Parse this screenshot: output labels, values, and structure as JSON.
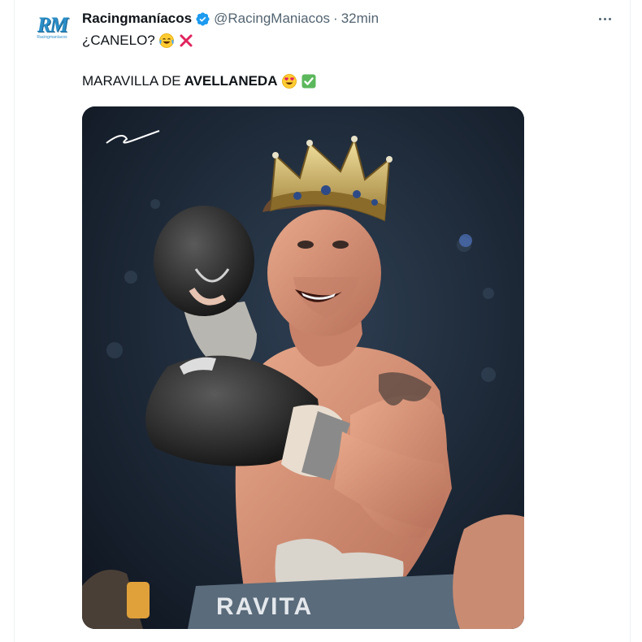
{
  "tweet": {
    "avatar_text": "RM",
    "avatar_sub": "Racingmaníacos",
    "display_name": "Racingmaníacos",
    "handle": "@RacingManiacos",
    "separator": "·",
    "time": "32min",
    "line1": "¿CANELO?",
    "line2_normal": "MARAVILLA DE",
    "line2_bold": "AVELLANEDA",
    "shorts_text": "RAVITA"
  },
  "icons": {
    "verified": "verified-badge-icon",
    "more": "more-options-icon",
    "emoji_laugh": "tears-of-joy-emoji",
    "emoji_cross": "cross-mark-emoji",
    "emoji_heart_eyes": "heart-eyes-emoji",
    "emoji_check": "check-mark-emoji"
  },
  "colors": {
    "verified_blue": "#1d9bf0",
    "secondary_text": "#536471",
    "logo_blue": "#2b8fc9"
  }
}
